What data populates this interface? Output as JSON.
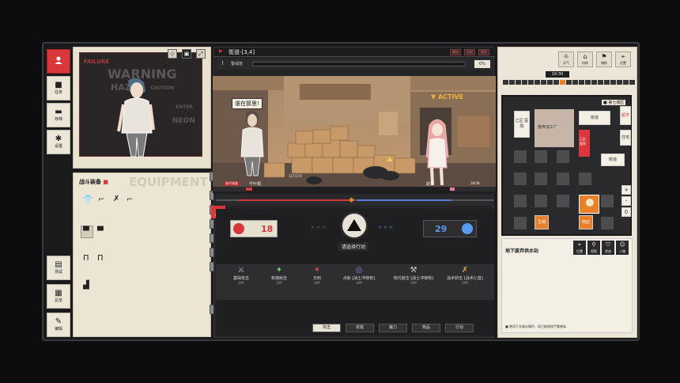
{
  "nav": {
    "profile": "",
    "tasks": "任务",
    "save": "存档",
    "settings": "设置",
    "test": "测试",
    "overview": "总览",
    "edit": "编辑"
  },
  "portrait": {
    "wm_warning": "WARNING",
    "wm_haz": "HAZ",
    "wm_caution": "CAUTION",
    "wm_failure": "FAILURE",
    "wm_neon": "NEON",
    "wm_enter": "ENTER"
  },
  "equipment": {
    "title": "战斗装备",
    "watermark": "EQUIPMENT"
  },
  "scene": {
    "location": "街道-[3,4]",
    "header_buttons": [
      "撤退",
      "回报",
      "暂停"
    ],
    "alert_label": "警戒度",
    "alert_pct": "0%",
    "alert_level": 0.0,
    "speech": "谁在那里!",
    "active": "▼ ACTIVE",
    "player_name": "千叶桐",
    "player_tag": "临时装备",
    "player_hp": "117/170",
    "enemy_name": "甜子",
    "enemy_hp": "38/38",
    "equip_label": "装备"
  },
  "combat": {
    "player_value": "18",
    "enemy_value": "29",
    "prompt": "请选择行动",
    "arrows_left": "> > >",
    "arrows_right": "< < <",
    "actions": [
      {
        "icon": "⚔",
        "name": "基础攻击",
        "ap": "1AP"
      },
      {
        "icon": "✦",
        "name": "枪械射击",
        "ap": "1AP"
      },
      {
        "icon": "✶",
        "name": "日刺",
        "ap": "2AP"
      },
      {
        "icon": "◎",
        "name": "点射 [战士冲锋枪]",
        "ap": "1AP"
      },
      {
        "icon": "⚒",
        "name": "枪托敲击 [战士冲锋枪]",
        "ap": "1AP"
      },
      {
        "icon": "✗",
        "name": "战术斩击 [战术匕首]",
        "ap": "1AP"
      }
    ],
    "tabs": [
      "攻击",
      "技能",
      "魔力",
      "物品",
      "行动"
    ]
  },
  "right": {
    "buttons": [
      "天气",
      "机库",
      "旗帜",
      "位置"
    ],
    "clock": "10:30",
    "district": "■ 第七城区",
    "rooms": {
      "a": "乙区\n医院",
      "b": "废弃加工厂",
      "c": "街道",
      "d": "超市",
      "e": "乙区\n医院",
      "f": "住宅",
      "g": "街道",
      "h": "主城",
      "i": "商店"
    },
    "info_title": "地下废弃供水站",
    "info_desc": "■ 曾用于全城水循环，现已被改造严重感染",
    "info_buttons": [
      "位置",
      "探索",
      "状态",
      "人物"
    ],
    "zoom": [
      "+",
      "-",
      "0"
    ]
  },
  "colors": {
    "accent_red": "#d8373b",
    "accent_orange": "#e8812a",
    "panel_cream": "#ebe6d8",
    "dark": "#1f1f21"
  }
}
